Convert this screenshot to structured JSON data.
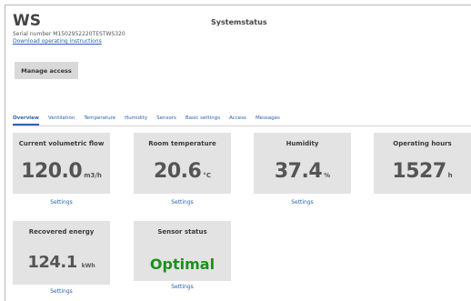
{
  "header": {
    "device_name": "WS",
    "serial_number": "Serial number M1502952220TESTWS320",
    "download_link": "Download operating instructions",
    "page_title": "Systemstatus",
    "manage_button": "Manage access"
  },
  "tabs": [
    {
      "label": "Overview",
      "active": true
    },
    {
      "label": "Ventilation",
      "active": false
    },
    {
      "label": "Temperature",
      "active": false
    },
    {
      "label": "Humidity",
      "active": false
    },
    {
      "label": "Sensors",
      "active": false
    },
    {
      "label": "Basic settings",
      "active": false
    },
    {
      "label": "Access",
      "active": false
    },
    {
      "label": "Messages",
      "active": false
    }
  ],
  "cards": {
    "volumetric_flow": {
      "title": "Current volumetric flow",
      "value": "120.0",
      "unit": "m3/h",
      "settings": "Settings"
    },
    "room_temperature": {
      "title": "Room temperature",
      "value": "20.6",
      "unit": "°C",
      "settings": "Settings"
    },
    "humidity": {
      "title": "Humidity",
      "value": "37.4",
      "unit": "%",
      "settings": "Settings"
    },
    "operating_hours": {
      "title": "Operating hours",
      "value": "1527",
      "unit": "h"
    },
    "recovered_energy": {
      "title": "Recovered energy",
      "value": "124.1",
      "unit": "kWh",
      "settings": "Settings"
    },
    "sensor_status": {
      "title": "Sensor status",
      "value": "Optimal",
      "settings": "Settings"
    }
  },
  "colors": {
    "link": "#2962b0",
    "card_bg": "#e3e3e3",
    "status_ok": "#1e8f1e",
    "button_bg": "#d9d9d9"
  }
}
